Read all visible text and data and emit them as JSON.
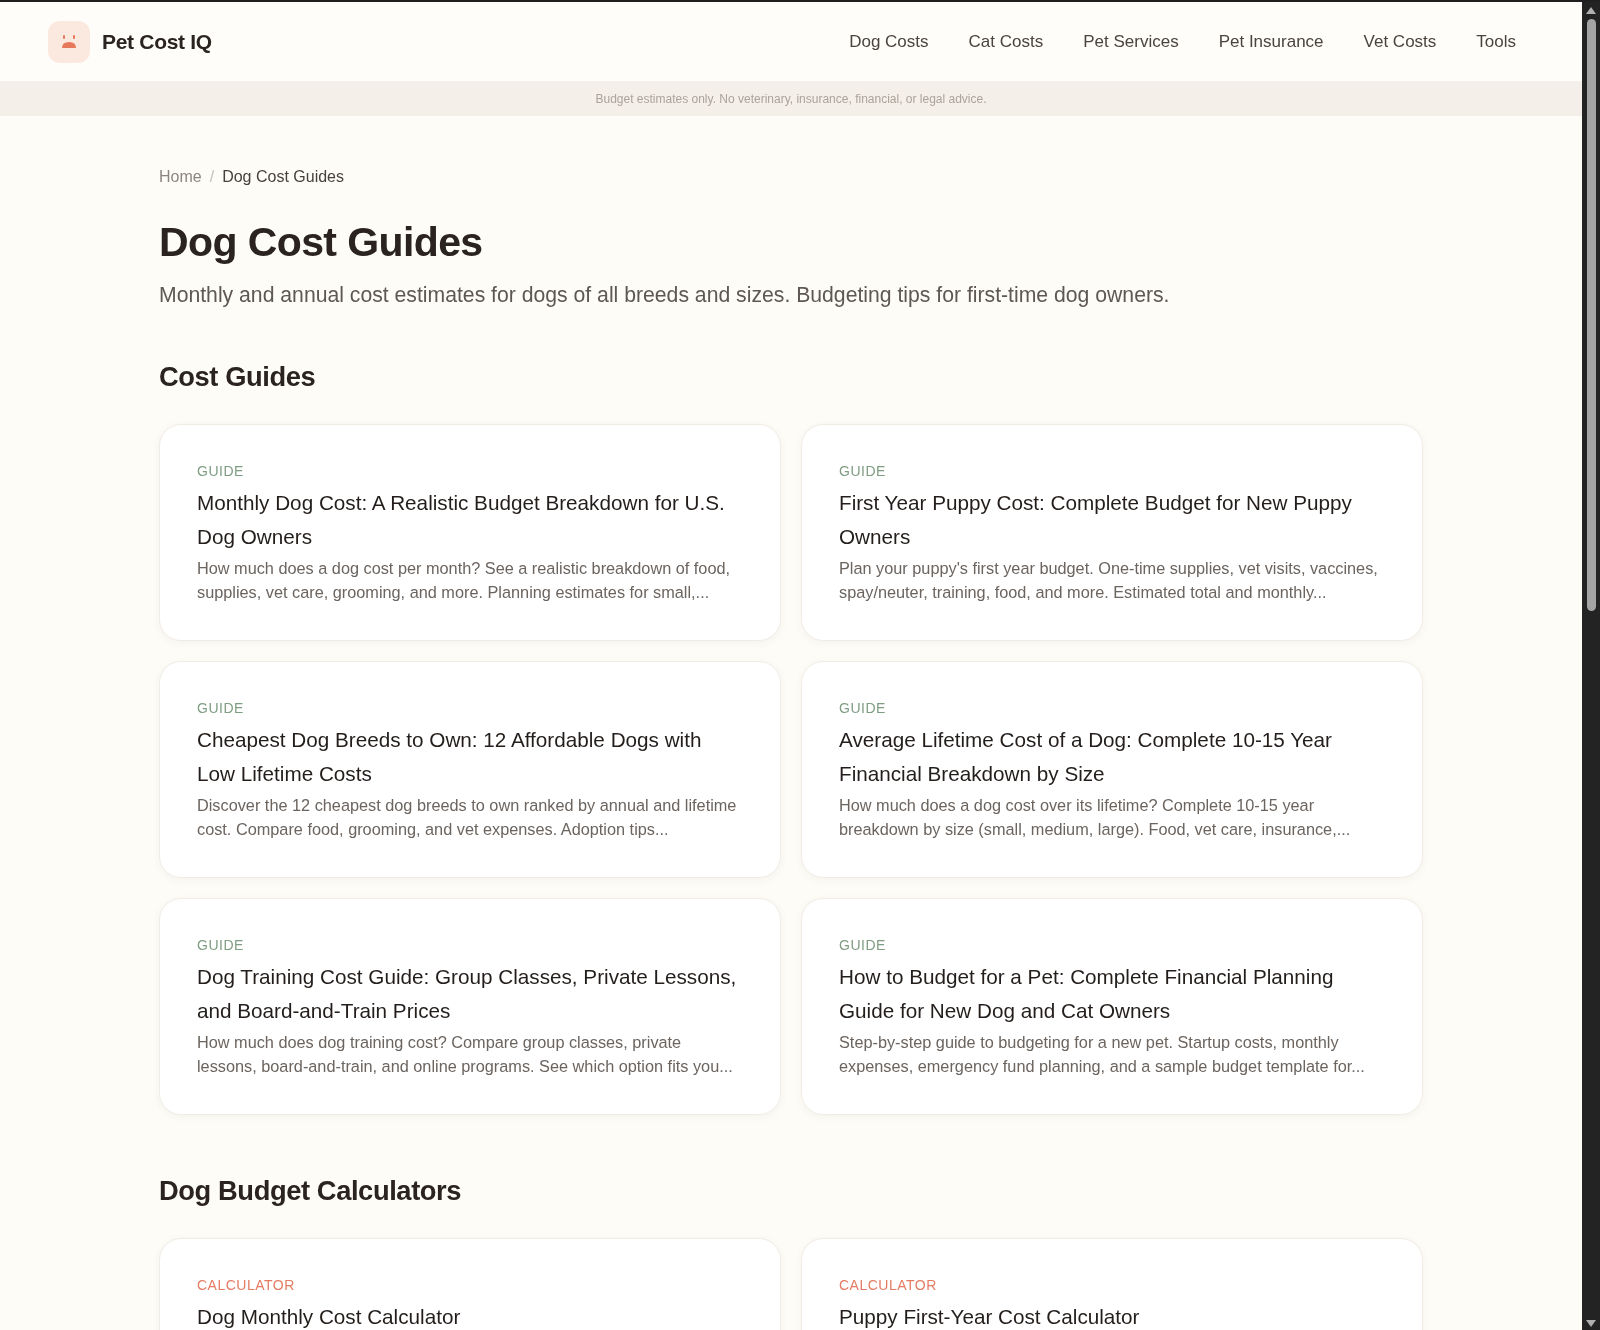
{
  "header": {
    "site_name": "Pet Cost IQ",
    "nav": [
      "Dog Costs",
      "Cat Costs",
      "Pet Services",
      "Pet Insurance",
      "Vet Costs",
      "Tools"
    ]
  },
  "disclaimer": "Budget estimates only. No veterinary, insurance, financial, or legal advice.",
  "breadcrumb": {
    "separator": "/",
    "items": [
      {
        "label": "Home",
        "current": false
      },
      {
        "label": "Dog Cost Guides",
        "current": true
      }
    ]
  },
  "page": {
    "title": "Dog Cost Guides",
    "subtitle": "Monthly and annual cost estimates for dogs of all breeds and sizes. Budgeting tips for first-time dog owners."
  },
  "sections": [
    {
      "heading": "Cost Guides",
      "cards": [
        {
          "kind": "guide",
          "tag": "GUIDE",
          "title": "Monthly Dog Cost: A Realistic Budget Breakdown for U.S. Dog Owners",
          "description": "How much does a dog cost per month? See a realistic breakdown of food, supplies, vet care, grooming, and more. Planning estimates for small,..."
        },
        {
          "kind": "guide",
          "tag": "GUIDE",
          "title": "First Year Puppy Cost: Complete Budget for New Puppy Owners",
          "description": "Plan your puppy's first year budget. One-time supplies, vet visits, vaccines, spay/neuter, training, food, and more. Estimated total and monthly..."
        },
        {
          "kind": "guide",
          "tag": "GUIDE",
          "title": "Cheapest Dog Breeds to Own: 12 Affordable Dogs with Low Lifetime Costs",
          "description": "Discover the 12 cheapest dog breeds to own ranked by annual and lifetime cost. Compare food, grooming, and vet expenses. Adoption tips..."
        },
        {
          "kind": "guide",
          "tag": "GUIDE",
          "title": "Average Lifetime Cost of a Dog: Complete 10-15 Year Financial Breakdown by Size",
          "description": "How much does a dog cost over its lifetime? Complete 10-15 year breakdown by size (small, medium, large). Food, vet care, insurance,..."
        },
        {
          "kind": "guide",
          "tag": "GUIDE",
          "title": "Dog Training Cost Guide: Group Classes, Private Lessons, and Board-and-Train Prices",
          "description": "How much does dog training cost? Compare group classes, private lessons, board-and-train, and online programs. See which option fits you..."
        },
        {
          "kind": "guide",
          "tag": "GUIDE",
          "title": "How to Budget for a Pet: Complete Financial Planning Guide for New Dog and Cat Owners",
          "description": "Step-by-step guide to budgeting for a new pet. Startup costs, monthly expenses, emergency fund planning, and a sample budget template for..."
        }
      ]
    },
    {
      "heading": "Dog Budget Calculators",
      "cards": [
        {
          "kind": "calculator",
          "tag": "CALCULATOR",
          "title": "Dog Monthly Cost Calculator"
        },
        {
          "kind": "calculator",
          "tag": "CALCULATOR",
          "title": "Puppy First-Year Cost Calculator"
        }
      ]
    }
  ]
}
